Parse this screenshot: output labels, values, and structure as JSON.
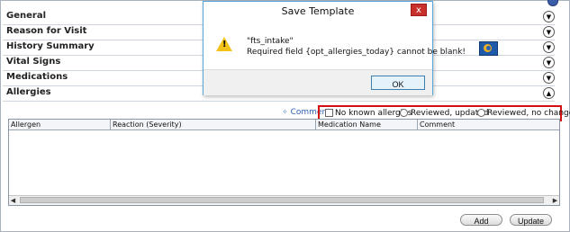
{
  "sections": [
    {
      "title": "General",
      "toggle": "chevron-down"
    },
    {
      "title": "Reason for Visit",
      "toggle": "chevron-down"
    },
    {
      "title": "History Summary",
      "toggle": "chevron-down"
    },
    {
      "title": "Vital Signs",
      "toggle": "chevron-down"
    },
    {
      "title": "Medications",
      "toggle": "chevron-down"
    },
    {
      "title": "Allergies",
      "toggle": "chevron-up"
    }
  ],
  "allergies": {
    "comment_link": "Comment",
    "options": {
      "no_known": "No known allergies",
      "reviewed_updated": "Reviewed, updated",
      "reviewed_no_changes": "Reviewed, no changes"
    },
    "columns": [
      "Allergen",
      "Reaction (Severity)",
      "Medication Name",
      "Comment"
    ],
    "add_label": "Add",
    "update_label": "Update"
  },
  "dialog": {
    "title": "Save Template",
    "close_glyph": "x",
    "line1": "\"fts_intake\"",
    "line2": "Required field {opt_allergies_today} cannot be blank!",
    "ok_label": "OK"
  },
  "colors": {
    "highlight_border": "#d40f0f",
    "title_accent": "#5aa8d8",
    "close_button": "#c9302c"
  }
}
